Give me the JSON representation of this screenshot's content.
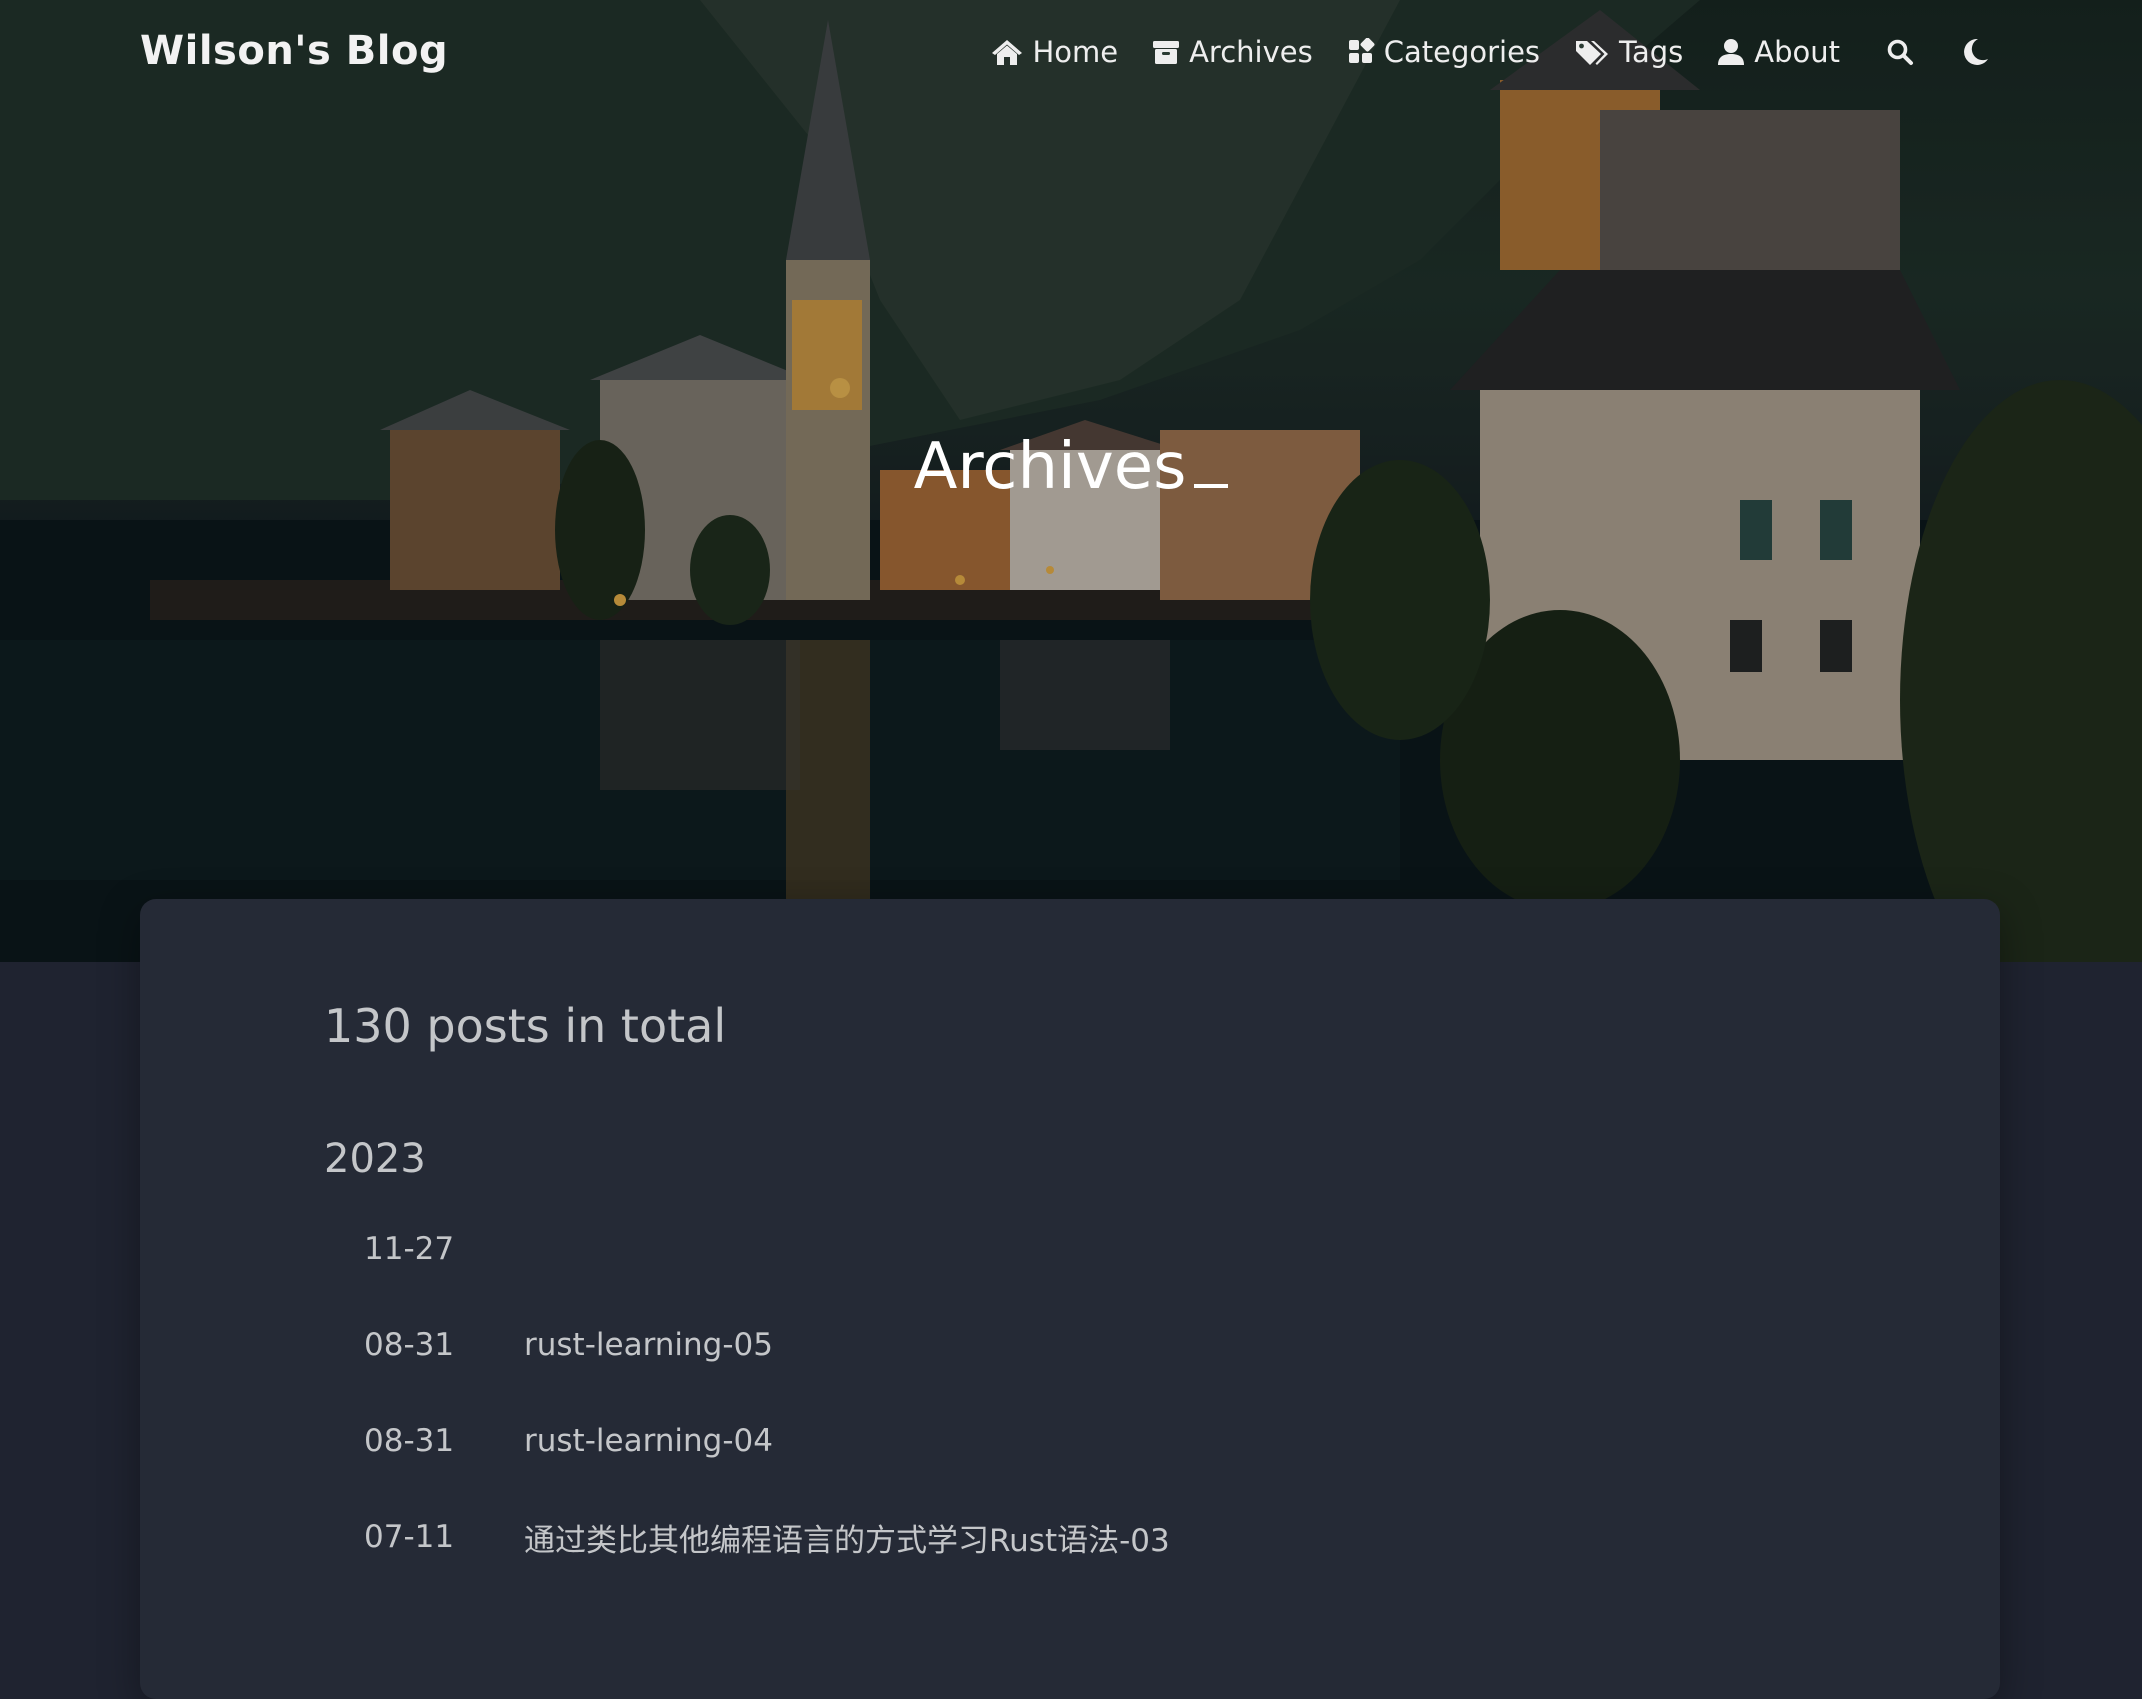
{
  "site": {
    "brand": "Wilson's Blog"
  },
  "nav": {
    "items": [
      {
        "label": "Home",
        "icon": "home-icon"
      },
      {
        "label": "Archives",
        "icon": "archive-icon"
      },
      {
        "label": "Categories",
        "icon": "categories-icon"
      },
      {
        "label": "Tags",
        "icon": "tags-icon"
      },
      {
        "label": "About",
        "icon": "user-icon"
      }
    ],
    "search_icon": "search-icon",
    "theme_icon": "moon-icon"
  },
  "banner": {
    "title": "Archives"
  },
  "archive": {
    "total": "130 posts in total",
    "year": "2023",
    "posts": [
      {
        "date": "11-27",
        "title": ""
      },
      {
        "date": "08-31",
        "title": "rust-learning-05"
      },
      {
        "date": "08-31",
        "title": "rust-learning-04"
      },
      {
        "date": "07-11",
        "title": "通过类比其他编程语言的方式学习Rust语法-03"
      }
    ]
  },
  "colors": {
    "board": "#252a36",
    "page": "#1f2330",
    "text": "#c4c6c9"
  }
}
